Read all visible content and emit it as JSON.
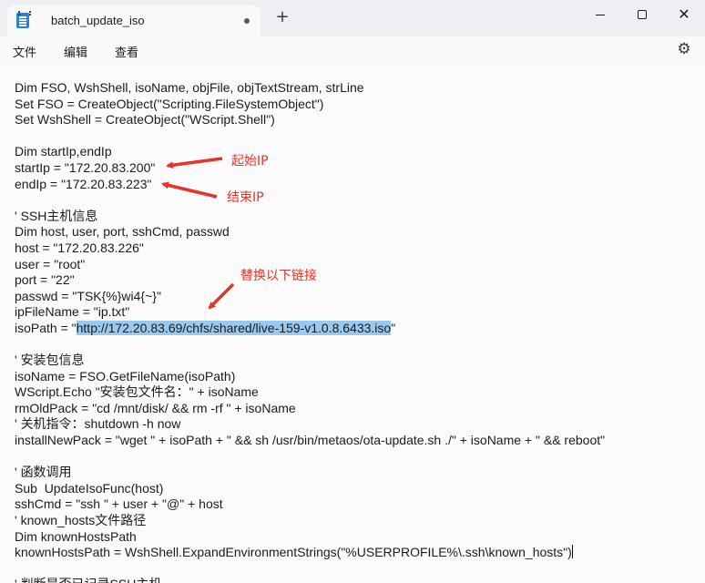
{
  "window": {
    "tab_title": "batch_update_iso",
    "new_tab_symbol": "+",
    "minimize_icon": "minimize-icon",
    "maximize_icon": "maximize-icon",
    "close_symbol": "✕"
  },
  "menu": {
    "file": "文件",
    "edit": "编辑",
    "view": "查看",
    "settings_icon": "gear-icon"
  },
  "editor": {
    "lines": [
      "Dim FSO, WshShell, isoName, objFile, objTextStream, strLine",
      "Set FSO = CreateObject(\"Scripting.FileSystemObject\")",
      "Set WshShell = CreateObject(\"WScript.Shell\")",
      "",
      "Dim startIp,endIp",
      "startIp = \"172.20.83.200\"",
      "endIp = \"172.20.83.223\"",
      "",
      "' SSH主机信息",
      "Dim host, user, port, sshCmd, passwd",
      "host = \"172.20.83.226\"",
      "user = \"root\"",
      "port = \"22\"",
      "passwd = \"TSK{%}wi4{~}\"",
      "ipFileName = \"ip.txt\"",
      "isoPath = \"http://172.20.83.69/chfs/shared/live-159-v1.0.8.6433.iso\"",
      "",
      "' 安装包信息",
      "isoName = FSO.GetFileName(isoPath)",
      "WScript.Echo \"安装包文件名：\" + isoName",
      "rmOldPack = \"cd /mnt/disk/ && rm -rf \" + isoName",
      "' 关机指令：shutdown -h now",
      "installNewPack = \"wget \" + isoPath + \" && sh /usr/bin/metaos/ota-update.sh ./\" + isoName + \" && reboot\"",
      "",
      "' 函数调用",
      "Sub  UpdateIsoFunc(host)",
      "sshCmd = \"ssh \" + user + \"@\" + host",
      "' known_hosts文件路径",
      "Dim knownHostsPath",
      "knownHostsPath = WshShell.ExpandEnvironmentStrings(\"%USERPROFILE%\\.ssh\\known_hosts\")",
      "",
      "' 判断是否已记录SSH主机"
    ],
    "iso_prefix": "isoPath = \"",
    "iso_selected": "http://172.20.83.69/chfs/shared/live-159-v1.0.8.6433.iso",
    "iso_suffix": "\""
  },
  "annotations": {
    "start_ip": "起始IP",
    "end_ip": "结束IP",
    "replace_link": "替换以下链接",
    "color": "#e8332a"
  },
  "colors": {
    "selection": "#99c9ef",
    "titlebar": "#eeeff3",
    "editor_bg": "#fbfbfb"
  }
}
